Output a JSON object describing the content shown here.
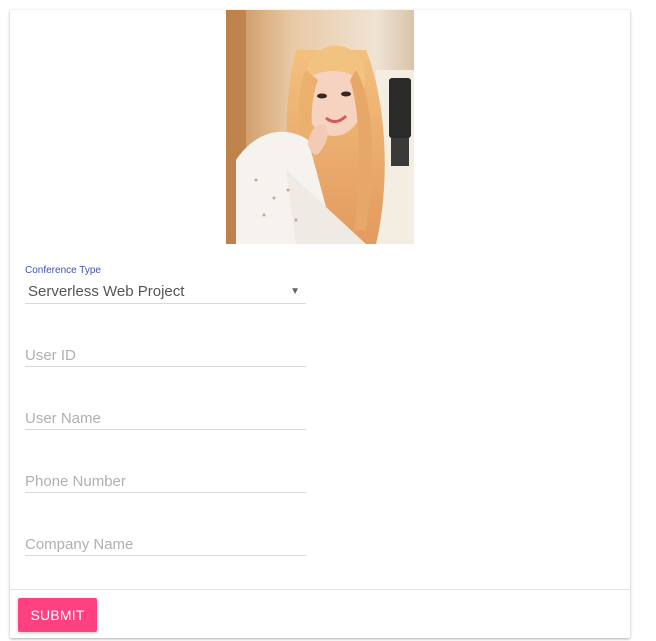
{
  "form": {
    "conference_type": {
      "label": "Conference Type",
      "value": "Serverless Web Project",
      "arrow": "▼"
    },
    "fields": {
      "user_id": {
        "placeholder": "User ID"
      },
      "user_name": {
        "placeholder": "User Name"
      },
      "phone_number": {
        "placeholder": "Phone Number"
      },
      "company_name": {
        "placeholder": "Company Name"
      }
    },
    "submit_label": "SUBMIT"
  },
  "colors": {
    "accent": "#3f51b5",
    "submit": "#ff4081"
  }
}
